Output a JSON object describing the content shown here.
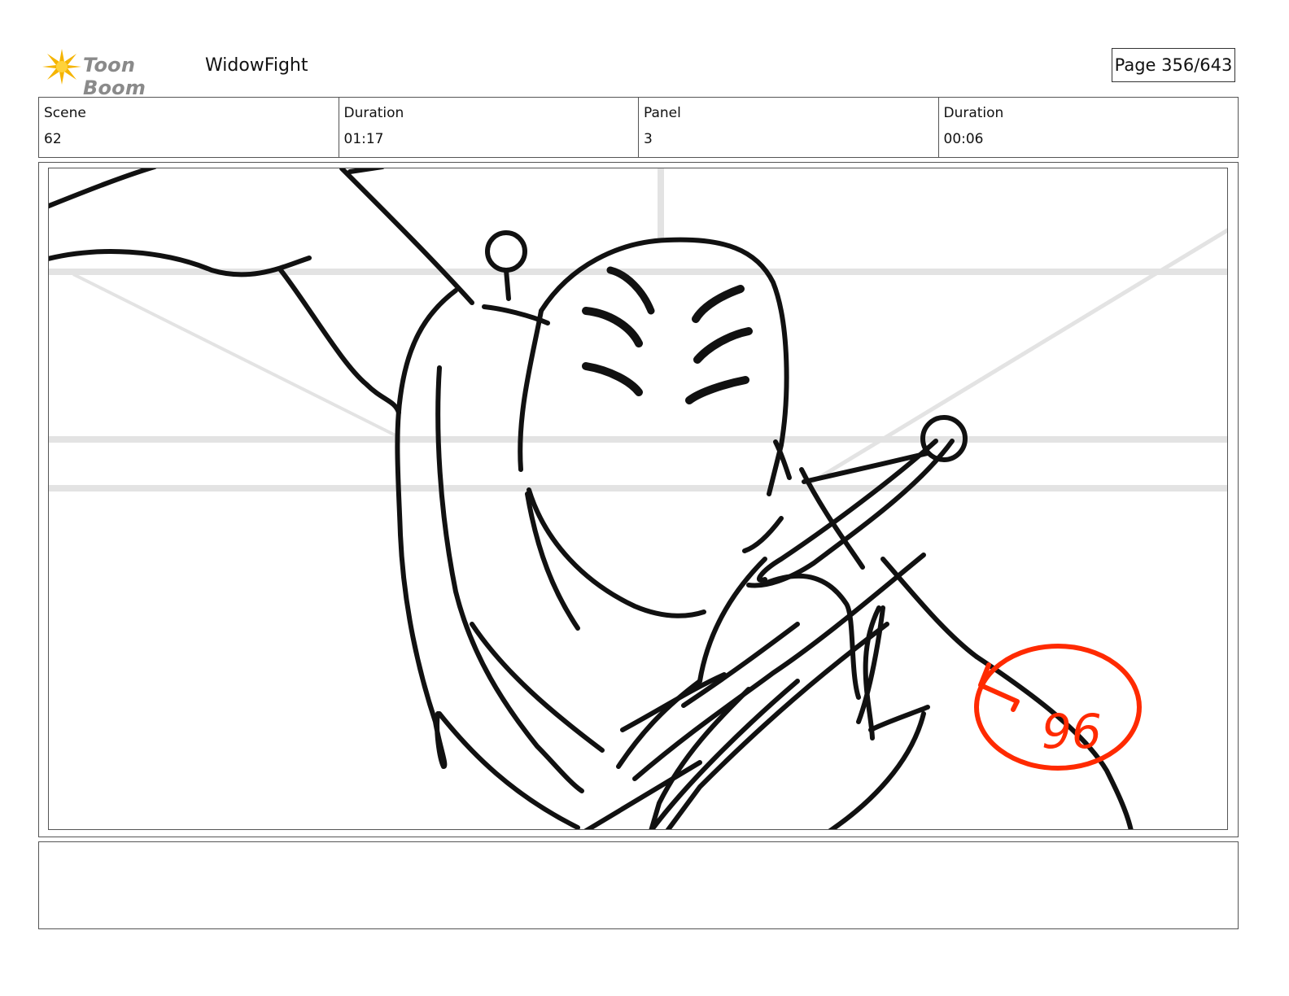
{
  "header": {
    "logo_text": "Toon Boom",
    "project_title": "WidowFight",
    "page_label": "Page 356/643"
  },
  "info": [
    {
      "label": "Scene",
      "value": "62"
    },
    {
      "label": "Duration",
      "value": "01:17"
    },
    {
      "label": "Panel",
      "value": "3"
    },
    {
      "label": "Duration",
      "value": "00:06"
    }
  ],
  "panel": {
    "annotation_number": "96",
    "annotation_color": "#ff2a00"
  },
  "notes": {
    "text": ""
  },
  "colors": {
    "logo_star": "#f5b400",
    "logo_text": "#8a8a8a",
    "border": "#555555",
    "sketch_line": "#111111",
    "guide_line": "#e3e3e3"
  }
}
